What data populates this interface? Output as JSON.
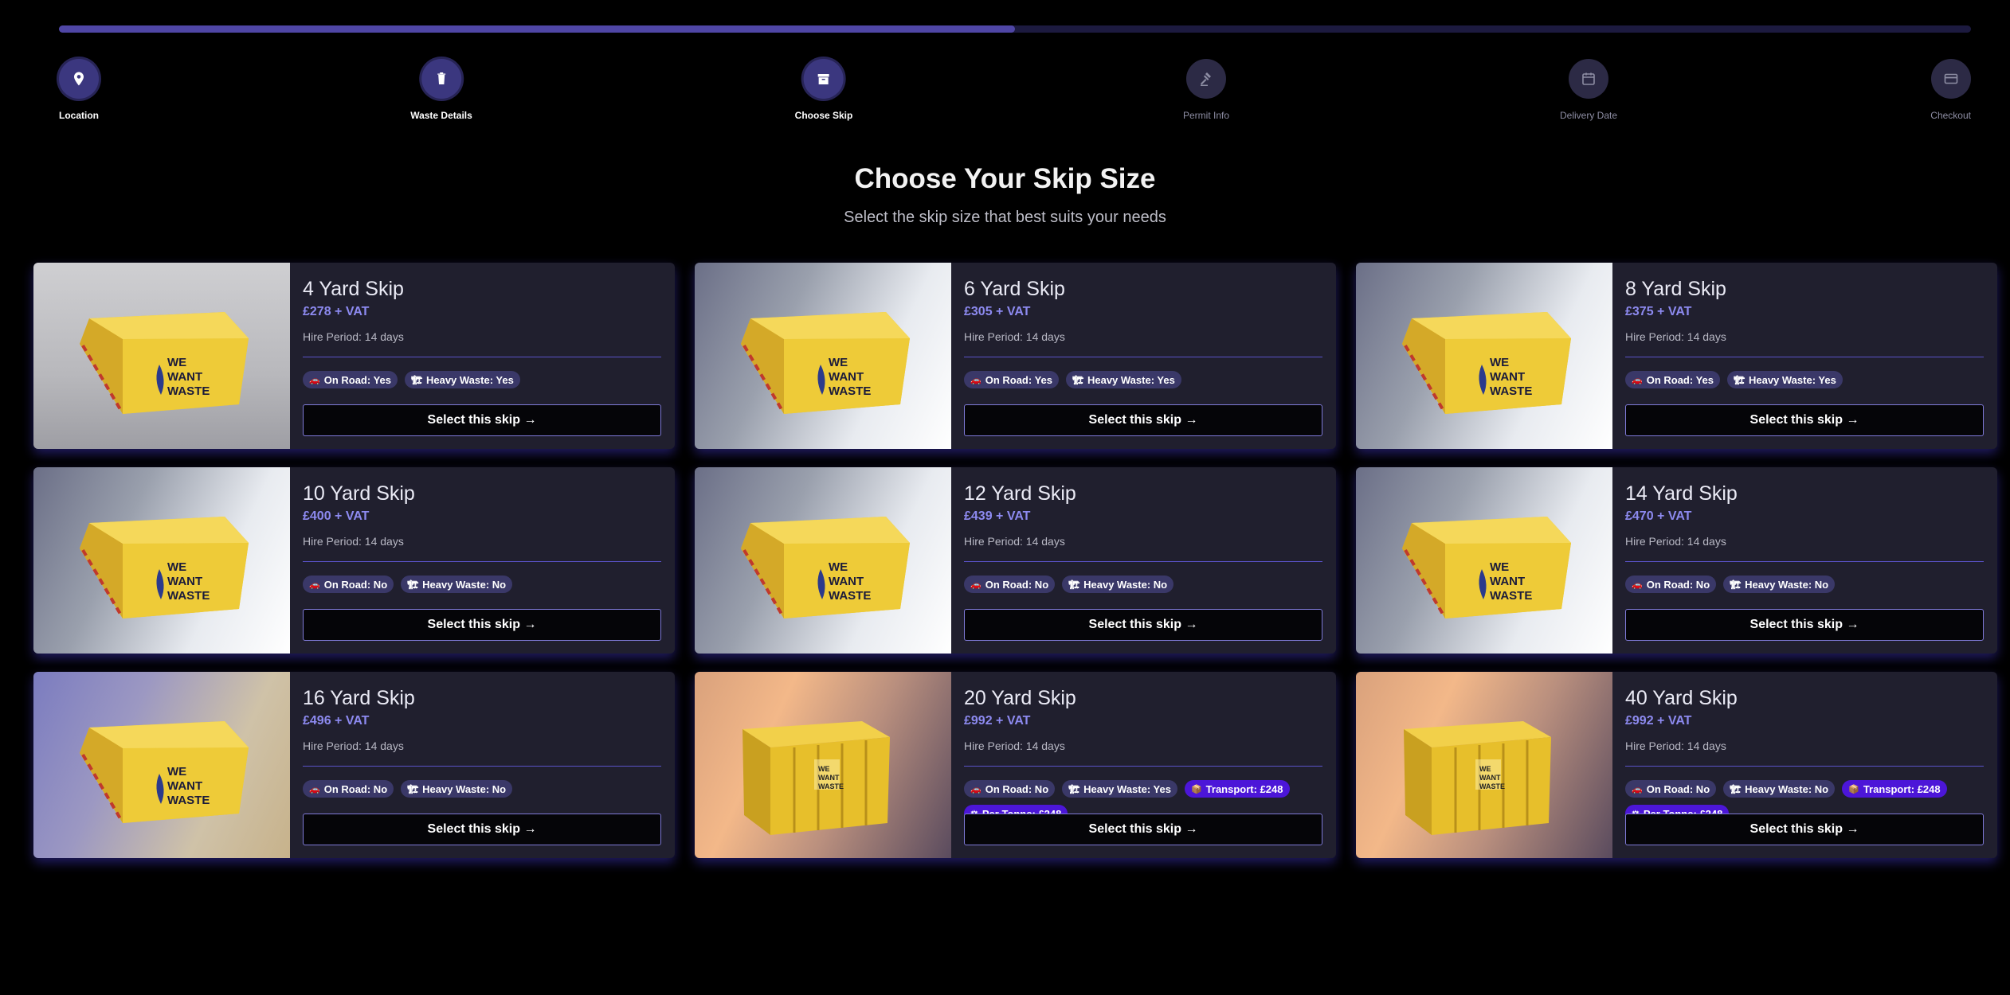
{
  "progress": {
    "fraction": 0.5
  },
  "steps": [
    {
      "label": "Location",
      "icon": "map-pin-icon",
      "state": "done"
    },
    {
      "label": "Waste Details",
      "icon": "trash-icon",
      "state": "done"
    },
    {
      "label": "Choose Skip",
      "icon": "box-icon",
      "state": "done"
    },
    {
      "label": "Permit Info",
      "icon": "gavel-icon",
      "state": "todo"
    },
    {
      "label": "Delivery Date",
      "icon": "calendar-icon",
      "state": "todo"
    },
    {
      "label": "Checkout",
      "icon": "credit-card-icon",
      "state": "todo"
    }
  ],
  "header": {
    "title": "Choose Your Skip Size",
    "subtitle": "Select the skip size that best suits your needs"
  },
  "cards": [
    {
      "name": "4 Yard Skip",
      "price": "£278 + VAT",
      "hire": "Hire Period: 14 days",
      "image": "grey",
      "badges": [
        {
          "icon": "🚗",
          "text": "On Road: Yes"
        },
        {
          "icon": "🏗",
          "text": "Heavy Waste: Yes"
        }
      ],
      "button": "Select this skip →"
    },
    {
      "name": "6 Yard Skip",
      "price": "£305 + VAT",
      "hire": "Hire Period: 14 days",
      "image": "cool",
      "badges": [
        {
          "icon": "🚗",
          "text": "On Road: Yes"
        },
        {
          "icon": "🏗",
          "text": "Heavy Waste: Yes"
        }
      ],
      "button": "Select this skip →"
    },
    {
      "name": "8 Yard Skip",
      "price": "£375 + VAT",
      "hire": "Hire Period: 14 days",
      "image": "cool",
      "badges": [
        {
          "icon": "🚗",
          "text": "On Road: Yes"
        },
        {
          "icon": "🏗",
          "text": "Heavy Waste: Yes"
        }
      ],
      "button": "Select this skip →"
    },
    {
      "name": "10 Yard Skip",
      "price": "£400 + VAT",
      "hire": "Hire Period: 14 days",
      "image": "cool",
      "badges": [
        {
          "icon": "🚗",
          "text": "On Road: No"
        },
        {
          "icon": "🏗",
          "text": "Heavy Waste: No"
        }
      ],
      "button": "Select this skip →"
    },
    {
      "name": "12 Yard Skip",
      "price": "£439 + VAT",
      "hire": "Hire Period: 14 days",
      "image": "cool",
      "badges": [
        {
          "icon": "🚗",
          "text": "On Road: No"
        },
        {
          "icon": "🏗",
          "text": "Heavy Waste: No"
        }
      ],
      "button": "Select this skip →"
    },
    {
      "name": "14 Yard Skip",
      "price": "£470 + VAT",
      "hire": "Hire Period: 14 days",
      "image": "cool",
      "badges": [
        {
          "icon": "🚗",
          "text": "On Road: No"
        },
        {
          "icon": "🏗",
          "text": "Heavy Waste: No"
        }
      ],
      "button": "Select this skip →"
    },
    {
      "name": "16 Yard Skip",
      "price": "£496 + VAT",
      "hire": "Hire Period: 14 days",
      "image": "purple",
      "badges": [
        {
          "icon": "🚗",
          "text": "On Road: No"
        },
        {
          "icon": "🏗",
          "text": "Heavy Waste: No"
        }
      ],
      "button": "Select this skip →"
    },
    {
      "name": "20 Yard Skip",
      "price": "£992 + VAT",
      "hire": "Hire Period: 14 days",
      "image": "warm",
      "badges": [
        {
          "icon": "🚗",
          "text": "On Road: No"
        },
        {
          "icon": "🏗",
          "text": "Heavy Waste: Yes"
        },
        {
          "icon": "📦",
          "text": "Transport: £248",
          "strong": true
        },
        {
          "icon": "⚖",
          "text": "Per Tonne: £248",
          "strong": true
        }
      ],
      "button": "Select this skip →"
    },
    {
      "name": "40 Yard Skip",
      "price": "£992 + VAT",
      "hire": "Hire Period: 14 days",
      "image": "warm",
      "badges": [
        {
          "icon": "🚗",
          "text": "On Road: No"
        },
        {
          "icon": "🏗",
          "text": "Heavy Waste: No"
        },
        {
          "icon": "📦",
          "text": "Transport: £248",
          "strong": true
        },
        {
          "icon": "⚖",
          "text": "Per Tonne: £248",
          "strong": true
        }
      ],
      "button": "Select this skip →"
    }
  ]
}
